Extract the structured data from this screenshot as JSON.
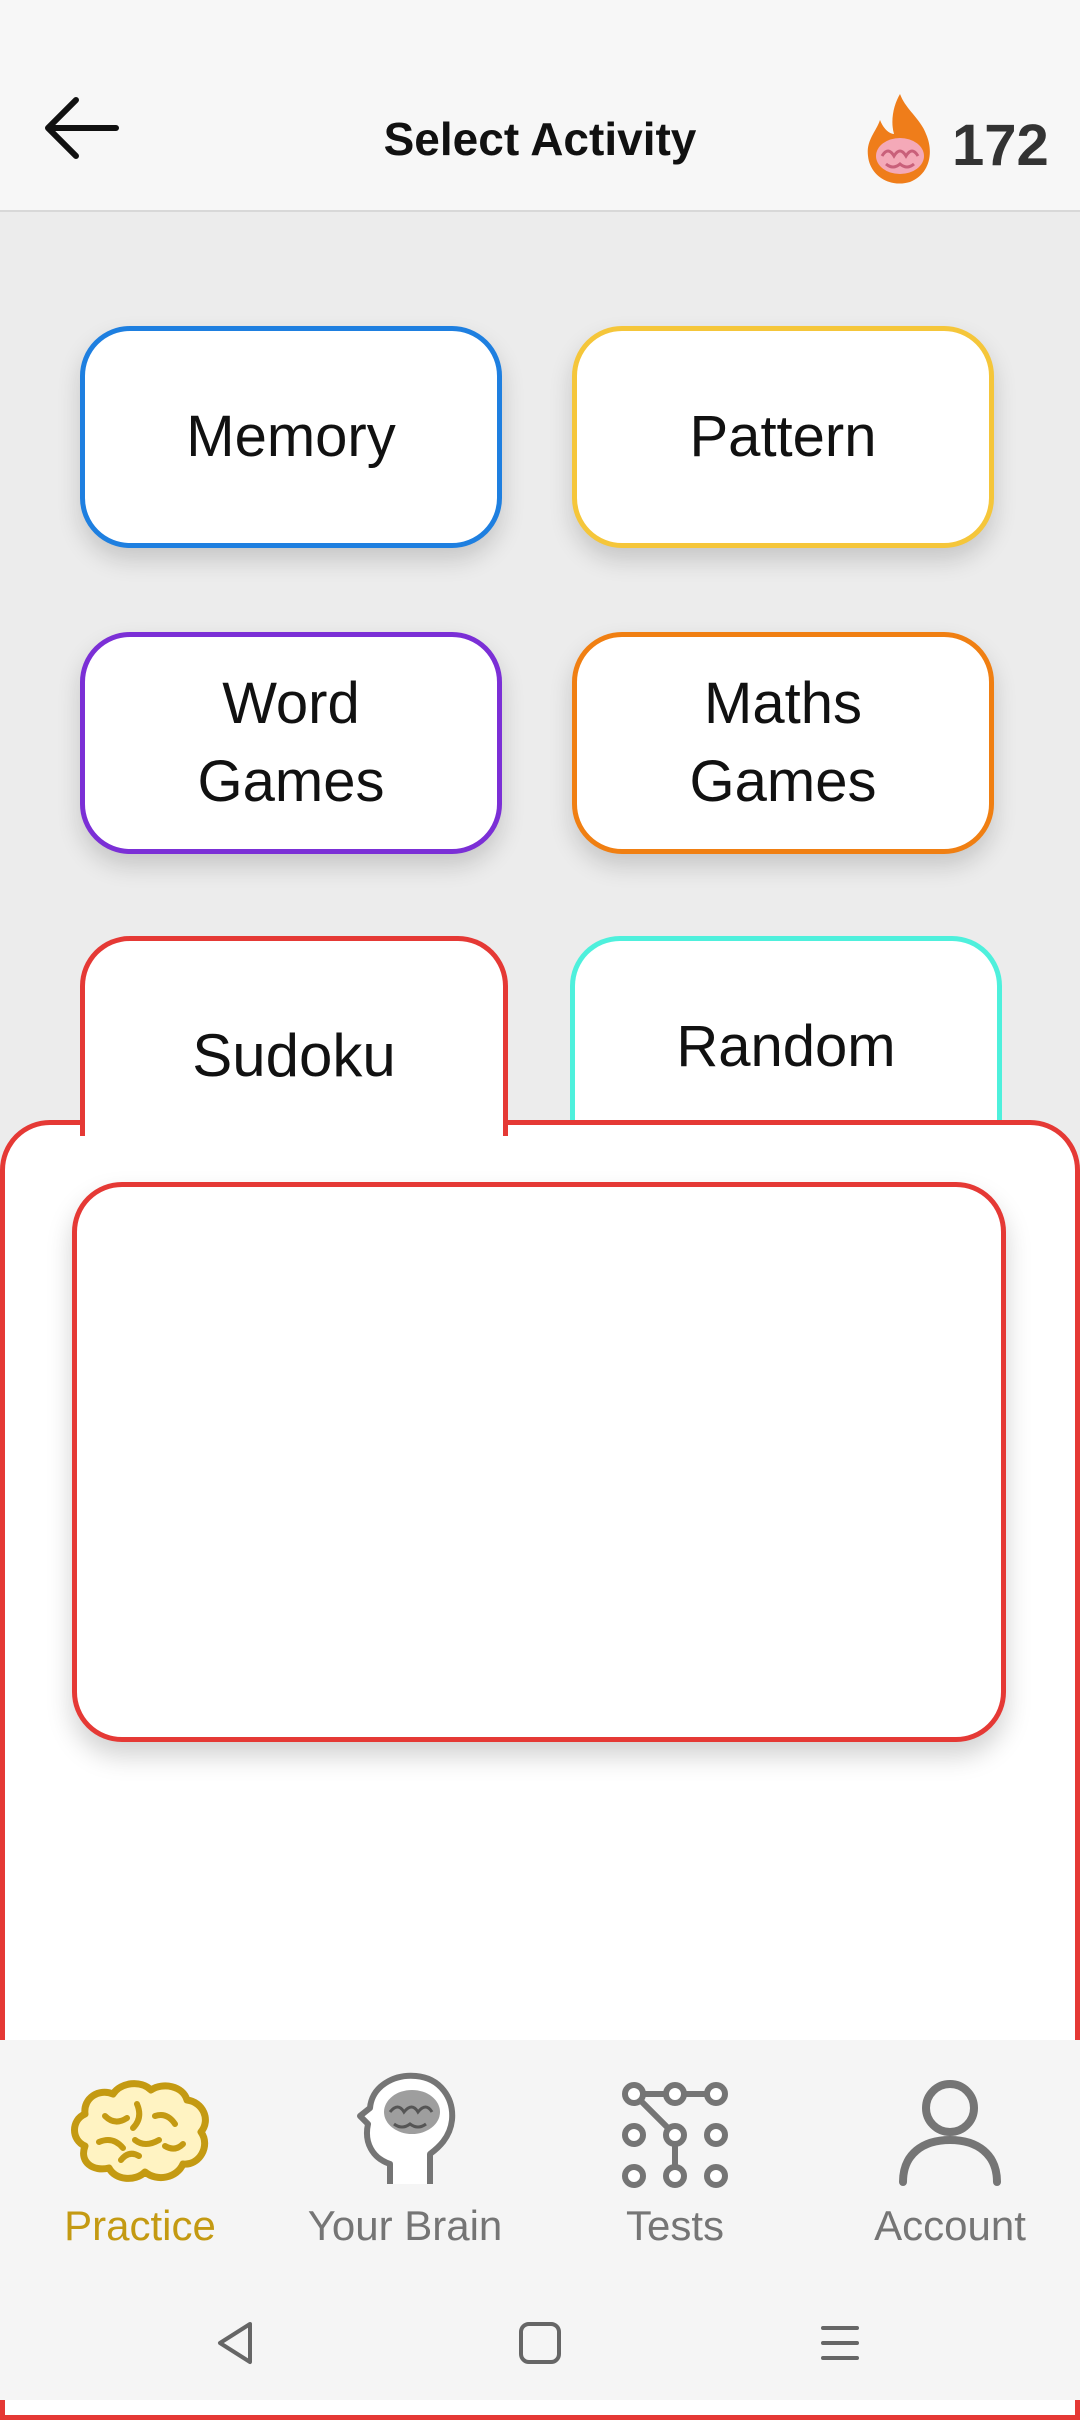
{
  "header": {
    "title": "Select Activity",
    "streak_count": "172"
  },
  "activities": {
    "memory": {
      "label": "Memory",
      "color": "#1e7fe0"
    },
    "pattern": {
      "label": "Pattern",
      "color": "#f5c63a"
    },
    "word_games": {
      "line1": "Word",
      "line2": "Games",
      "color": "#7b2fd6"
    },
    "maths_games": {
      "line1": "Maths",
      "line2": "Games",
      "color": "#f07f12"
    },
    "sudoku": {
      "label": "Sudoku",
      "color": "#e53935"
    },
    "random": {
      "label": "Random",
      "color": "#4ef0dc"
    }
  },
  "bottom_nav": {
    "items": [
      {
        "label": "Practice",
        "icon": "brain-icon",
        "active": true
      },
      {
        "label": "Your Brain",
        "icon": "head-brain-icon",
        "active": false
      },
      {
        "label": "Tests",
        "icon": "pattern-grid-icon",
        "active": false
      },
      {
        "label": "Account",
        "icon": "person-icon",
        "active": false
      }
    ]
  },
  "system_nav": {
    "buttons": [
      "back-triangle-icon",
      "home-square-icon",
      "menu-lines-icon"
    ]
  },
  "colors": {
    "active_nav": "#c49a12",
    "inactive_nav": "#757575",
    "streak_flame": "#ef7d1a"
  }
}
